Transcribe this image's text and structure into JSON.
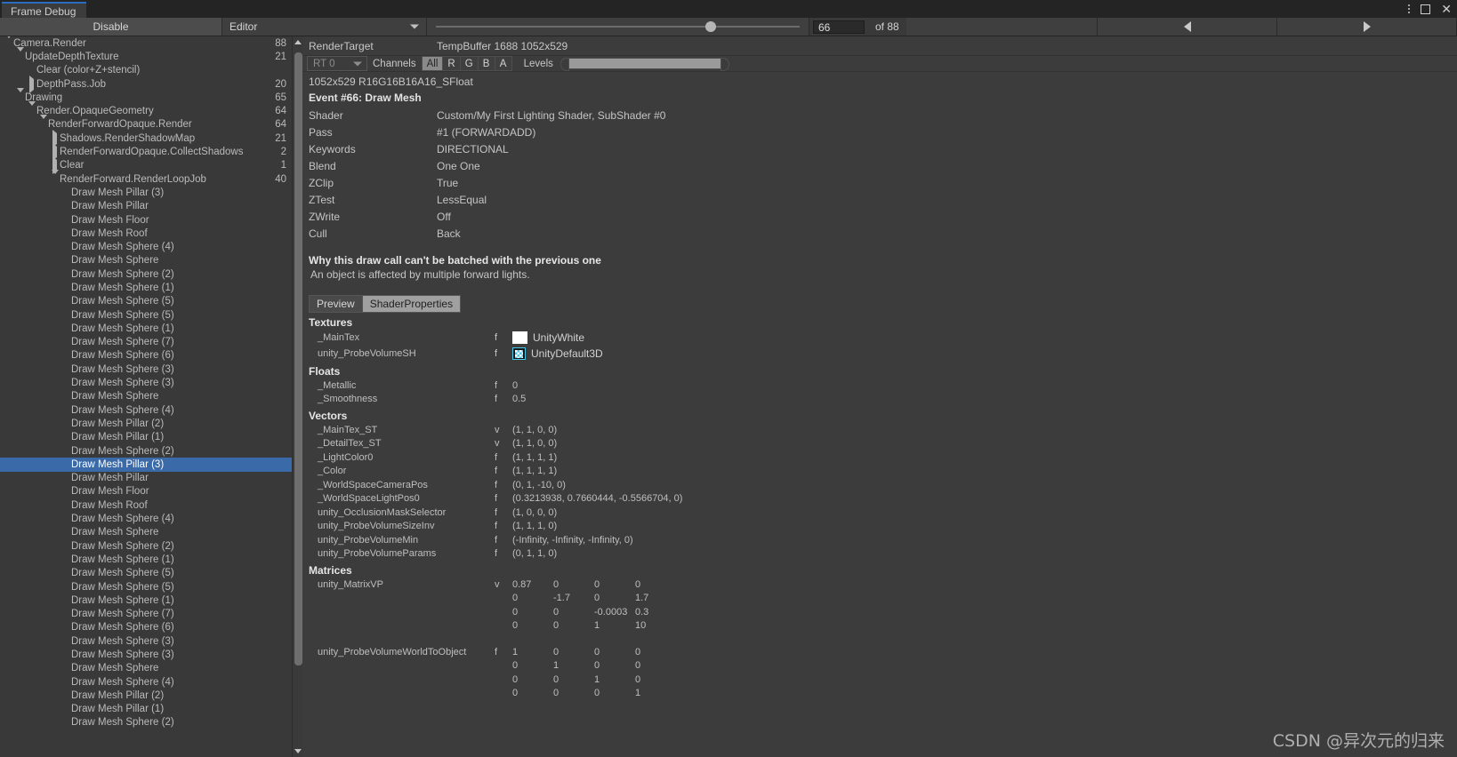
{
  "window": {
    "tab_title": "Frame Debug",
    "menu_icon": "kebab-menu-icon",
    "maximize_icon": "maximize-icon",
    "close_icon": "close-icon"
  },
  "toolbar": {
    "disable_label": "Disable",
    "target_label": "Editor",
    "event_value": "66",
    "event_total_label": "of 88",
    "prev_icon": "triangle-left-icon",
    "next_icon": "triangle-right-icon",
    "slider_percent": 74
  },
  "tree": {
    "rows": [
      {
        "depth": 0,
        "twisty": "down",
        "label": "Camera.Render",
        "count": "88",
        "selected": false
      },
      {
        "depth": 1,
        "twisty": "down",
        "label": "UpdateDepthTexture",
        "count": "21",
        "selected": false
      },
      {
        "depth": 2,
        "twisty": "none",
        "label": "Clear (color+Z+stencil)",
        "count": "",
        "selected": false
      },
      {
        "depth": 2,
        "twisty": "right",
        "label": "DepthPass.Job",
        "count": "20",
        "selected": false
      },
      {
        "depth": 1,
        "twisty": "down",
        "label": "Drawing",
        "count": "65",
        "selected": false
      },
      {
        "depth": 2,
        "twisty": "down",
        "label": "Render.OpaqueGeometry",
        "count": "64",
        "selected": false
      },
      {
        "depth": 3,
        "twisty": "down",
        "label": "RenderForwardOpaque.Render",
        "count": "64",
        "selected": false
      },
      {
        "depth": 4,
        "twisty": "right",
        "label": "Shadows.RenderShadowMap",
        "count": "21",
        "selected": false
      },
      {
        "depth": 4,
        "twisty": "right",
        "label": "RenderForwardOpaque.CollectShadows",
        "count": "2",
        "selected": false
      },
      {
        "depth": 4,
        "twisty": "right",
        "label": "Clear",
        "count": "1",
        "selected": false
      },
      {
        "depth": 4,
        "twisty": "down",
        "label": "RenderForward.RenderLoopJob",
        "count": "40",
        "selected": false
      },
      {
        "depth": 5,
        "twisty": "none",
        "label": "Draw Mesh Pillar (3)",
        "count": "",
        "selected": false
      },
      {
        "depth": 5,
        "twisty": "none",
        "label": "Draw Mesh Pillar",
        "count": "",
        "selected": false
      },
      {
        "depth": 5,
        "twisty": "none",
        "label": "Draw Mesh Floor",
        "count": "",
        "selected": false
      },
      {
        "depth": 5,
        "twisty": "none",
        "label": "Draw Mesh Roof",
        "count": "",
        "selected": false
      },
      {
        "depth": 5,
        "twisty": "none",
        "label": "Draw Mesh Sphere (4)",
        "count": "",
        "selected": false
      },
      {
        "depth": 5,
        "twisty": "none",
        "label": "Draw Mesh Sphere",
        "count": "",
        "selected": false
      },
      {
        "depth": 5,
        "twisty": "none",
        "label": "Draw Mesh Sphere (2)",
        "count": "",
        "selected": false
      },
      {
        "depth": 5,
        "twisty": "none",
        "label": "Draw Mesh Sphere (1)",
        "count": "",
        "selected": false
      },
      {
        "depth": 5,
        "twisty": "none",
        "label": "Draw Mesh Sphere (5)",
        "count": "",
        "selected": false
      },
      {
        "depth": 5,
        "twisty": "none",
        "label": "Draw Mesh Sphere (5)",
        "count": "",
        "selected": false
      },
      {
        "depth": 5,
        "twisty": "none",
        "label": "Draw Mesh Sphere (1)",
        "count": "",
        "selected": false
      },
      {
        "depth": 5,
        "twisty": "none",
        "label": "Draw Mesh Sphere (7)",
        "count": "",
        "selected": false
      },
      {
        "depth": 5,
        "twisty": "none",
        "label": "Draw Mesh Sphere (6)",
        "count": "",
        "selected": false
      },
      {
        "depth": 5,
        "twisty": "none",
        "label": "Draw Mesh Sphere (3)",
        "count": "",
        "selected": false
      },
      {
        "depth": 5,
        "twisty": "none",
        "label": "Draw Mesh Sphere (3)",
        "count": "",
        "selected": false
      },
      {
        "depth": 5,
        "twisty": "none",
        "label": "Draw Mesh Sphere",
        "count": "",
        "selected": false
      },
      {
        "depth": 5,
        "twisty": "none",
        "label": "Draw Mesh Sphere (4)",
        "count": "",
        "selected": false
      },
      {
        "depth": 5,
        "twisty": "none",
        "label": "Draw Mesh Pillar (2)",
        "count": "",
        "selected": false
      },
      {
        "depth": 5,
        "twisty": "none",
        "label": "Draw Mesh Pillar (1)",
        "count": "",
        "selected": false
      },
      {
        "depth": 5,
        "twisty": "none",
        "label": "Draw Mesh Sphere (2)",
        "count": "",
        "selected": false
      },
      {
        "depth": 5,
        "twisty": "none",
        "label": "Draw Mesh Pillar (3)",
        "count": "",
        "selected": true
      },
      {
        "depth": 5,
        "twisty": "none",
        "label": "Draw Mesh Pillar",
        "count": "",
        "selected": false
      },
      {
        "depth": 5,
        "twisty": "none",
        "label": "Draw Mesh Floor",
        "count": "",
        "selected": false
      },
      {
        "depth": 5,
        "twisty": "none",
        "label": "Draw Mesh Roof",
        "count": "",
        "selected": false
      },
      {
        "depth": 5,
        "twisty": "none",
        "label": "Draw Mesh Sphere (4)",
        "count": "",
        "selected": false
      },
      {
        "depth": 5,
        "twisty": "none",
        "label": "Draw Mesh Sphere",
        "count": "",
        "selected": false
      },
      {
        "depth": 5,
        "twisty": "none",
        "label": "Draw Mesh Sphere (2)",
        "count": "",
        "selected": false
      },
      {
        "depth": 5,
        "twisty": "none",
        "label": "Draw Mesh Sphere (1)",
        "count": "",
        "selected": false
      },
      {
        "depth": 5,
        "twisty": "none",
        "label": "Draw Mesh Sphere (5)",
        "count": "",
        "selected": false
      },
      {
        "depth": 5,
        "twisty": "none",
        "label": "Draw Mesh Sphere (5)",
        "count": "",
        "selected": false
      },
      {
        "depth": 5,
        "twisty": "none",
        "label": "Draw Mesh Sphere (1)",
        "count": "",
        "selected": false
      },
      {
        "depth": 5,
        "twisty": "none",
        "label": "Draw Mesh Sphere (7)",
        "count": "",
        "selected": false
      },
      {
        "depth": 5,
        "twisty": "none",
        "label": "Draw Mesh Sphere (6)",
        "count": "",
        "selected": false
      },
      {
        "depth": 5,
        "twisty": "none",
        "label": "Draw Mesh Sphere (3)",
        "count": "",
        "selected": false
      },
      {
        "depth": 5,
        "twisty": "none",
        "label": "Draw Mesh Sphere (3)",
        "count": "",
        "selected": false
      },
      {
        "depth": 5,
        "twisty": "none",
        "label": "Draw Mesh Sphere",
        "count": "",
        "selected": false
      },
      {
        "depth": 5,
        "twisty": "none",
        "label": "Draw Mesh Sphere (4)",
        "count": "",
        "selected": false
      },
      {
        "depth": 5,
        "twisty": "none",
        "label": "Draw Mesh Pillar (2)",
        "count": "",
        "selected": false
      },
      {
        "depth": 5,
        "twisty": "none",
        "label": "Draw Mesh Pillar (1)",
        "count": "",
        "selected": false
      },
      {
        "depth": 5,
        "twisty": "none",
        "label": "Draw Mesh Sphere (2)",
        "count": "",
        "selected": false
      }
    ]
  },
  "detail": {
    "render_target_key": "RenderTarget",
    "render_target_value": "TempBuffer 1688 1052x529",
    "rt_select": "RT 0",
    "channels_label": "Channels",
    "channels": [
      "All",
      "R",
      "G",
      "B",
      "A"
    ],
    "channel_active": "All",
    "levels_label": "Levels",
    "format_line": "1052x529 R16G16B16A16_SFloat",
    "event_title": "Event #66: Draw Mesh",
    "props": [
      {
        "k": "Shader",
        "v": "Custom/My First Lighting Shader, SubShader #0"
      },
      {
        "k": "Pass",
        "v": "#1 (FORWARDADD)"
      },
      {
        "k": "Keywords",
        "v": "DIRECTIONAL"
      },
      {
        "k": "Blend",
        "v": "One One"
      },
      {
        "k": "ZClip",
        "v": "True"
      },
      {
        "k": "ZTest",
        "v": "LessEqual"
      },
      {
        "k": "ZWrite",
        "v": "Off"
      },
      {
        "k": "Cull",
        "v": "Back"
      }
    ],
    "why_title": "Why this draw call can't be batched with the previous one",
    "why_body": "An object is affected by multiple forward lights.",
    "tabs": [
      {
        "label": "Preview",
        "active": false
      },
      {
        "label": "ShaderProperties",
        "active": true
      }
    ],
    "textures_title": "Textures",
    "textures": [
      {
        "name": "_MainTex",
        "type": "f",
        "value": "UnityWhite",
        "swatch": "white"
      },
      {
        "name": "unity_ProbeVolumeSH",
        "type": "f",
        "value": "UnityDefault3D",
        "swatch": "checker3d"
      }
    ],
    "floats_title": "Floats",
    "floats": [
      {
        "name": "_Metallic",
        "type": "f",
        "value": "0"
      },
      {
        "name": "_Smoothness",
        "type": "f",
        "value": "0.5"
      }
    ],
    "vectors_title": "Vectors",
    "vectors": [
      {
        "name": "_MainTex_ST",
        "type": "v",
        "value": "(1, 1, 0, 0)"
      },
      {
        "name": "_DetailTex_ST",
        "type": "v",
        "value": "(1, 1, 0, 0)"
      },
      {
        "name": "_LightColor0",
        "type": "f",
        "value": "(1, 1, 1, 1)"
      },
      {
        "name": "_Color",
        "type": "f",
        "value": "(1, 1, 1, 1)"
      },
      {
        "name": "_WorldSpaceCameraPos",
        "type": "f",
        "value": "(0, 1, -10, 0)"
      },
      {
        "name": "_WorldSpaceLightPos0",
        "type": "f",
        "value": "(0.3213938, 0.7660444, -0.5566704, 0)"
      },
      {
        "name": "unity_OcclusionMaskSelector",
        "type": "f",
        "value": "(1, 0, 0, 0)"
      },
      {
        "name": "unity_ProbeVolumeSizeInv",
        "type": "f",
        "value": "(1, 1, 1, 0)"
      },
      {
        "name": "unity_ProbeVolumeMin",
        "type": "f",
        "value": "(-Infinity, -Infinity, -Infinity, 0)"
      },
      {
        "name": "unity_ProbeVolumeParams",
        "type": "f",
        "value": "(0, 1, 1, 0)"
      }
    ],
    "matrices_title": "Matrices",
    "matrices": [
      {
        "name": "unity_MatrixVP",
        "type": "v",
        "rows": [
          [
            "0.87",
            "0",
            "0",
            "0"
          ],
          [
            "0",
            "-1.7",
            "0",
            "1.7"
          ],
          [
            "0",
            "0",
            "-0.0003",
            "0.3"
          ],
          [
            "0",
            "0",
            "1",
            "10"
          ]
        ]
      },
      {
        "name": "unity_ProbeVolumeWorldToObject",
        "type": "f",
        "rows": [
          [
            "1",
            "0",
            "0",
            "0"
          ],
          [
            "0",
            "1",
            "0",
            "0"
          ],
          [
            "0",
            "0",
            "1",
            "0"
          ],
          [
            "0",
            "0",
            "0",
            "1"
          ]
        ]
      }
    ]
  },
  "watermark": "CSDN @异次元的归来"
}
